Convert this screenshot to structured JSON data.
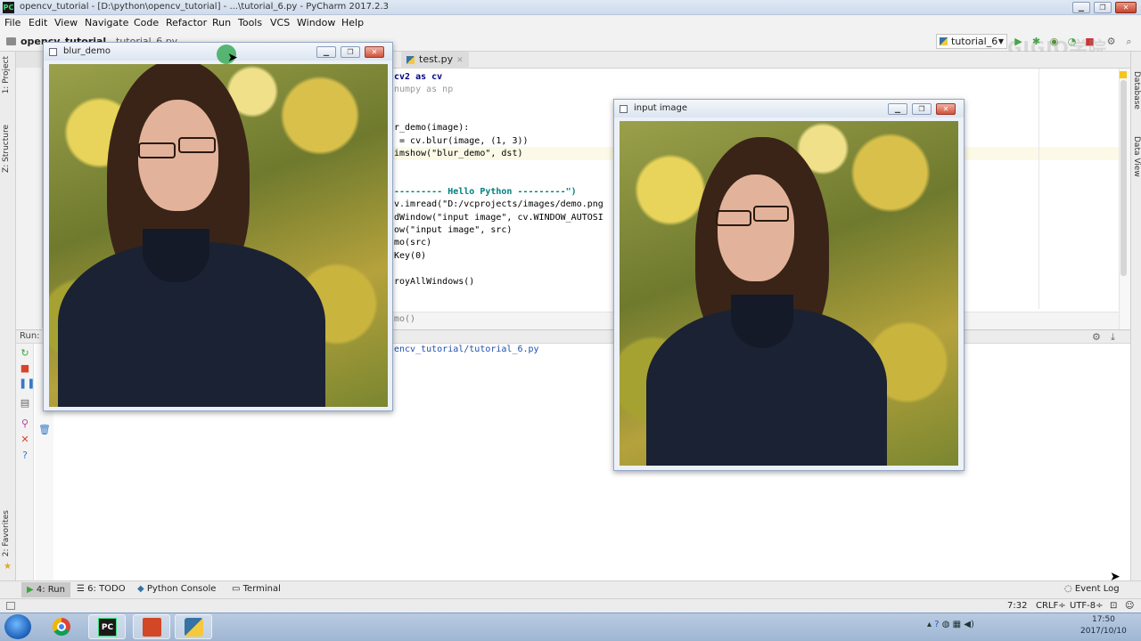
{
  "window": {
    "title": "opencv_tutorial - [D:\\python\\opencv_tutorial] - ...\\tutorial_6.py - PyCharm 2017.2.3",
    "app_icon": "PC"
  },
  "menu": [
    "File",
    "Edit",
    "View",
    "Navigate",
    "Code",
    "Refactor",
    "Run",
    "Tools",
    "VCS",
    "Window",
    "Help"
  ],
  "navbar": {
    "project": "opencv_tutorial",
    "file": "tutorial_6.py",
    "run_config": "tutorial_6"
  },
  "watermark": "GIGIO学院",
  "left_strip": {
    "project": "1: Project",
    "structure": "Z: Structure",
    "favorites": "2: Favorites"
  },
  "right_strip": {
    "database": "Database",
    "data_view": "Data View"
  },
  "editor": {
    "tab": "test.py",
    "lines": [
      {
        "text": "cv2 as cv",
        "style": "kw"
      },
      {
        "text": "numpy as np",
        "style": "gray"
      },
      {
        "text": "r_demo(image):",
        "style": "plain"
      },
      {
        "text": " = cv.blur(image, (1, 3))",
        "style": "plain"
      },
      {
        "text": "imshow(\"blur_demo\", dst)",
        "style": "plain"
      },
      {
        "text": "--------- Hello Python ---------\")",
        "style": "str"
      },
      {
        "text": "v.imread(\"D:/vcprojects/images/demo.png",
        "style": "plain"
      },
      {
        "text": "dWindow(\"input image\", cv.WINDOW_AUTOSI",
        "style": "plain"
      },
      {
        "text": "ow(\"input image\", src)",
        "style": "plain"
      },
      {
        "text": "mo(src)",
        "style": "plain"
      },
      {
        "text": "Key(0)",
        "style": "plain"
      },
      {
        "text": "royAllWindows()",
        "style": "plain"
      },
      {
        "text": "mo()",
        "style": "dim"
      }
    ]
  },
  "run_panel": {
    "label": "Run:",
    "output": "encv_tutorial/tutorial_6.py"
  },
  "tool_tabs": {
    "run": "4: Run",
    "todo": "6: TODO",
    "python_console": "Python Console",
    "terminal": "Terminal",
    "event_log": "Event Log"
  },
  "status": {
    "position": "7:32",
    "line_sep": "CRLF÷",
    "encoding": "UTF-8÷"
  },
  "taskbar": {
    "clock_time": "17:50",
    "clock_date": "2017/10/10"
  },
  "windows": {
    "blur": {
      "title": "blur_demo"
    },
    "input": {
      "title": "input image"
    }
  }
}
